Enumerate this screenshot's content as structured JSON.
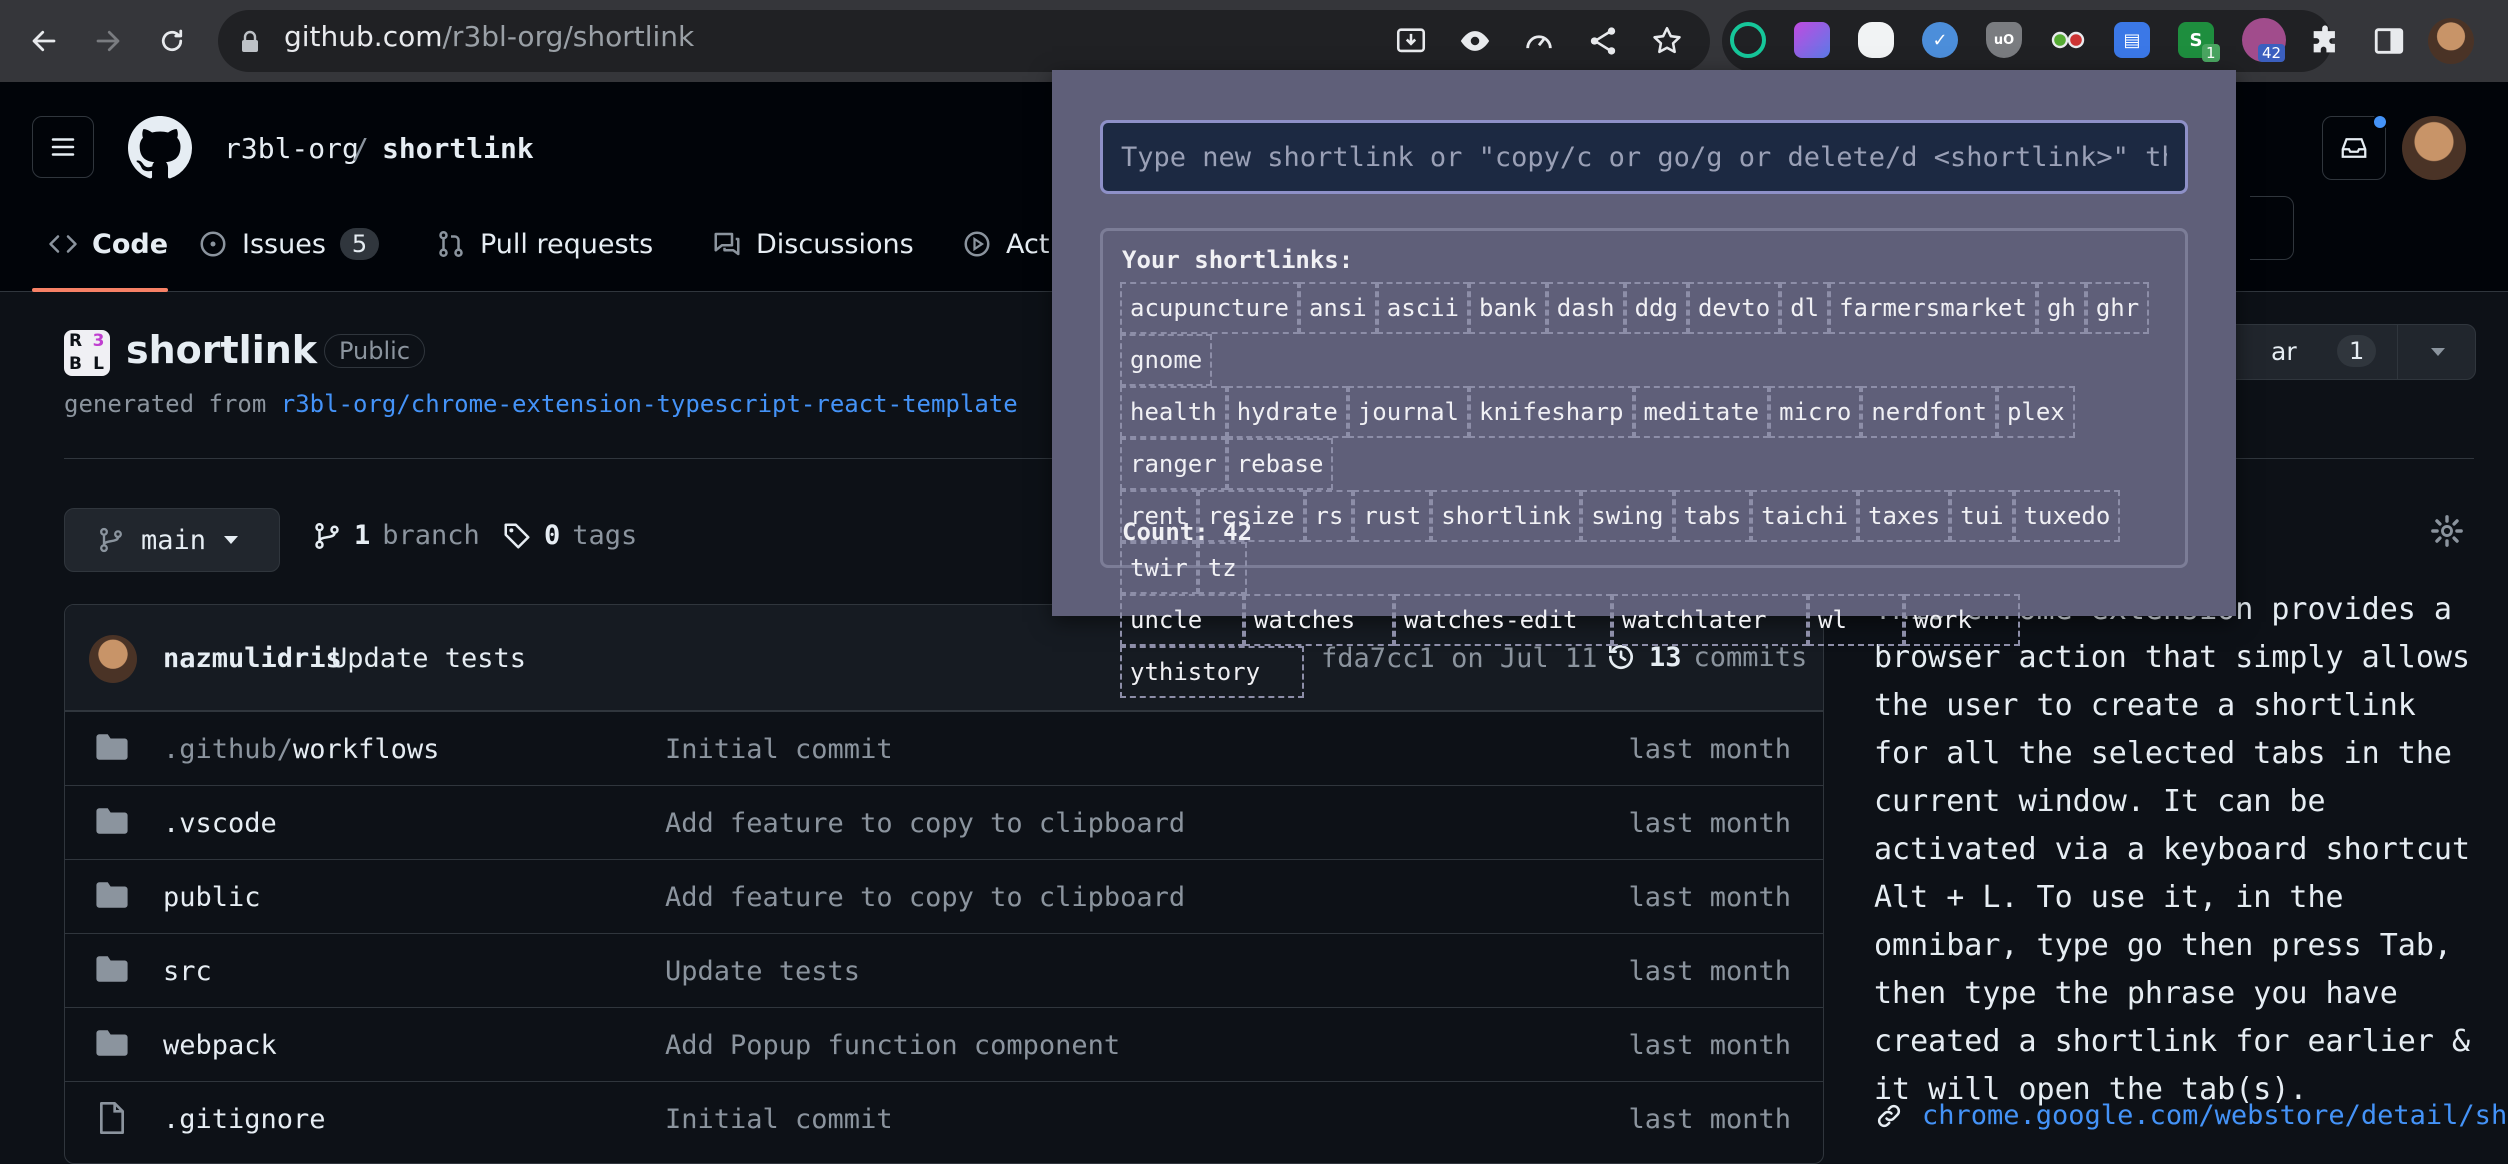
{
  "browser": {
    "url_host": "github.com",
    "url_path": "/r3bl-org/shortlink",
    "extension_badges": {
      "s": "1",
      "shortlink": "42"
    }
  },
  "header": {
    "owner": "r3bl-org",
    "separator": "/",
    "repo": "shortlink",
    "tabs": [
      {
        "label": "Code"
      },
      {
        "label": "Issues",
        "count": "5"
      },
      {
        "label": "Pull requests"
      },
      {
        "label": "Discussions"
      },
      {
        "label": "Act"
      }
    ]
  },
  "repo": {
    "logo_letters": [
      "R",
      "3",
      "B",
      "L"
    ],
    "name": "shortlink",
    "visibility": "Public",
    "generated_prefix": "generated from",
    "template_link": "r3bl-org/chrome-extension-typescript-react-template",
    "branch": "main",
    "branch_count": "1",
    "branch_label": "branch",
    "tag_count": "0",
    "tag_label": "tags",
    "star_label_fragment": "ar",
    "star_count": "1"
  },
  "commit": {
    "author": "nazmulidris",
    "message": "Update tests",
    "sha": "fda7cc1",
    "date": "on Jul 11",
    "count": "13",
    "count_label": "commits"
  },
  "files": [
    {
      "type": "folder",
      "name_dim": ".github/",
      "name": "workflows",
      "commit": "Initial commit",
      "when": "last month"
    },
    {
      "type": "folder",
      "name_dim": "",
      "name": ".vscode",
      "commit": "Add feature to copy to clipboard",
      "when": "last month"
    },
    {
      "type": "folder",
      "name_dim": "",
      "name": "public",
      "commit": "Add feature to copy to clipboard",
      "when": "last month"
    },
    {
      "type": "folder",
      "name_dim": "",
      "name": "src",
      "commit": "Update tests",
      "when": "last month"
    },
    {
      "type": "folder",
      "name_dim": "",
      "name": "webpack",
      "commit": "Add Popup function component",
      "when": "last month"
    },
    {
      "type": "file",
      "name_dim": "",
      "name": ".gitignore",
      "commit": "Initial commit",
      "when": "last month"
    }
  ],
  "about": {
    "description": "This chrome extension provides a browser action that simply allows the user to create a shortlink for all the selected tabs in the current window. It can be activated via a keyboard shortcut Alt + L. To use it, in the omnibar, type go then press Tab, then type the phrase you have created a shortlink for earlier & it will open the tab(s).",
    "link": "chrome.google.com/webstore/detail/sho…"
  },
  "popup": {
    "placeholder": "Type new shortlink or \"copy/c or go/g or delete/d <shortlink>\" then Enter",
    "title": "Your shortlinks:",
    "shortlinks": [
      "acupuncture",
      "ansi",
      "ascii",
      "bank",
      "dash",
      "ddg",
      "devto",
      "dl",
      "farmersmarket",
      "gh",
      "ghr",
      "gnome",
      "health",
      "hydrate",
      "journal",
      "knifesharp",
      "meditate",
      "micro",
      "nerdfont",
      "plex",
      "ranger",
      "rebase",
      "rent",
      "resize",
      "rs",
      "rust",
      "shortlink",
      "swing",
      "tabs",
      "taichi",
      "taxes",
      "tui",
      "tuxedo",
      "twir",
      "tz",
      "uncle",
      "watches",
      "watches-edit",
      "watchlater",
      "wl",
      "work",
      "ythistory"
    ],
    "count_label": "Count: 42"
  },
  "colors": {
    "accent": "#f78166",
    "link": "#4493f8",
    "popup_bg": "#5f5f79",
    "input_border": "#8e90c8"
  }
}
